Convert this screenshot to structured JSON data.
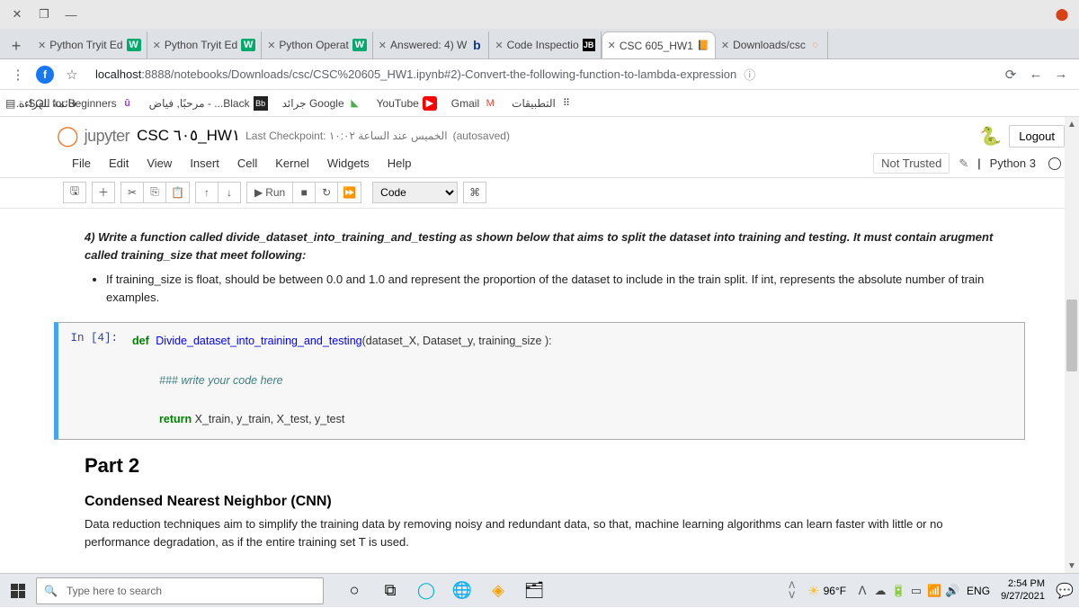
{
  "browser": {
    "tabs": [
      {
        "label": "Python Tryit Ed",
        "icon": "w3"
      },
      {
        "label": "Python Tryit Ed",
        "icon": "w3"
      },
      {
        "label": "Python Operat",
        "icon": "w3"
      },
      {
        "label": "Answered: 4) W",
        "icon": "b"
      },
      {
        "label": "Code Inspectio",
        "icon": "jb"
      },
      {
        "label": "CSC 605_HW1",
        "icon": "jup",
        "active": true
      },
      {
        "label": "Downloads/csc",
        "icon": "jup-r"
      }
    ],
    "url_host": "localhost",
    "url_rest": ":8888/notebooks/Downloads/csc/CSC%20605_HW1.ipynb#2)-Convert-the-following-function-to-lambda-expression",
    "bookmarks": [
      {
        "label": "SQL for Beginners:..."
      },
      {
        "label": "Black... - مرحبًا, فياض"
      },
      {
        "label": "Google جرائد"
      },
      {
        "label": "YouTube"
      },
      {
        "label": "Gmail"
      },
      {
        "label": "التطبيقات"
      }
    ],
    "reading_list": "قائمة القراءة"
  },
  "notebook": {
    "word": "jupyter",
    "title": "CSC ٦٠٥_HW١",
    "checkpoint": "Last Checkpoint: الخميس عند الساعة ١٠:٠٢",
    "autosaved": "(autosaved)",
    "logout": "Logout",
    "menu": [
      "File",
      "Edit",
      "View",
      "Insert",
      "Cell",
      "Kernel",
      "Widgets",
      "Help"
    ],
    "not_trusted": "Not Trusted",
    "kernel": "Python 3",
    "run_label": "Run",
    "cell_type": "Code",
    "q4_a": "4) Write a function called divide_dataset_into_training_and_testing as shown below that aims to split the dataset into training and testing. It must contain arugment called training_size that meet following:",
    "q4_b": "If training_size is float, should be between 0.0 and 1.0 and represent the proportion of the dataset to include in the train split. If int, represents the absolute number of train examples.",
    "prompt": "In [4]:",
    "code_def": "def",
    "code_fn": "Divide_dataset_into_training_and_testing",
    "code_args": "(dataset_X, Dataset_y, training_size ):",
    "code_cmt": "### write your code here",
    "code_ret": "return",
    "code_retv": " X_train, y_train, X_test, y_test",
    "part2": "Part 2",
    "cnn_h": "Condensed Nearest Neighbor (CNN)",
    "cnn_p": "Data reduction techniques aim to simplify the training data by removing noisy and redundant data, so that, machine learning algorithms can learn faster with little or no performance degradation, as if the entire training set T is used."
  },
  "taskbar": {
    "search": "Type here to search",
    "temp": "96°F",
    "lang": "ENG",
    "time": "2:54 PM",
    "date": "9/27/2021"
  }
}
